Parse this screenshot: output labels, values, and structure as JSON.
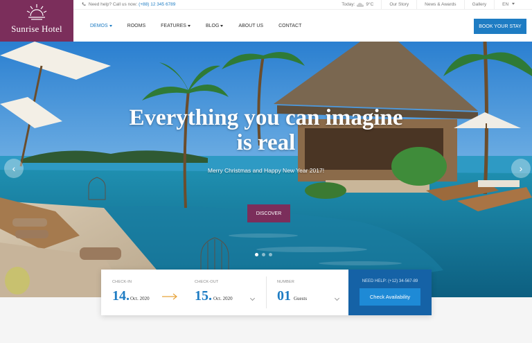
{
  "logo": {
    "name": "Sunrise Hotel"
  },
  "topbar": {
    "help_text": "Need help? Call us now:",
    "phone": "(+88) 12 345 6789",
    "weather_label": "Today:",
    "temperature": "9°C",
    "links": [
      "Our Story",
      "News & Awards",
      "Gallery"
    ],
    "language": "EN"
  },
  "nav": {
    "items": [
      {
        "label": "DEMOS",
        "dropdown": true,
        "active": true
      },
      {
        "label": "ROOMS",
        "dropdown": false
      },
      {
        "label": "FEATURES",
        "dropdown": true
      },
      {
        "label": "BLOG",
        "dropdown": true
      },
      {
        "label": "ABOUT US",
        "dropdown": false
      },
      {
        "label": "CONTACT",
        "dropdown": false
      }
    ],
    "book_label": "BOOK YOUR STAY"
  },
  "hero": {
    "title_line1": "Everything you can imagine",
    "title_line2": "is real",
    "subtitle": "Merry Christmas and Happy New Year 2017!",
    "button": "DISCOVER",
    "prev": "‹",
    "next": "›"
  },
  "booking": {
    "checkin": {
      "label": "CHECK-IN",
      "day": "14.",
      "month": "Oct. 2020"
    },
    "checkout": {
      "label": "CHECK-OUT",
      "day": "15.",
      "month": "Oct. 2020"
    },
    "guests": {
      "label": "NUMBER",
      "count": "01",
      "unit": "Guests"
    },
    "need_help": "NEED HELP: (+12) 34-567-89",
    "check_button": "Check Availability"
  },
  "colors": {
    "brand": "#7b2e5b",
    "accent": "#1e7cc3",
    "help_bg": "#1562a6"
  }
}
